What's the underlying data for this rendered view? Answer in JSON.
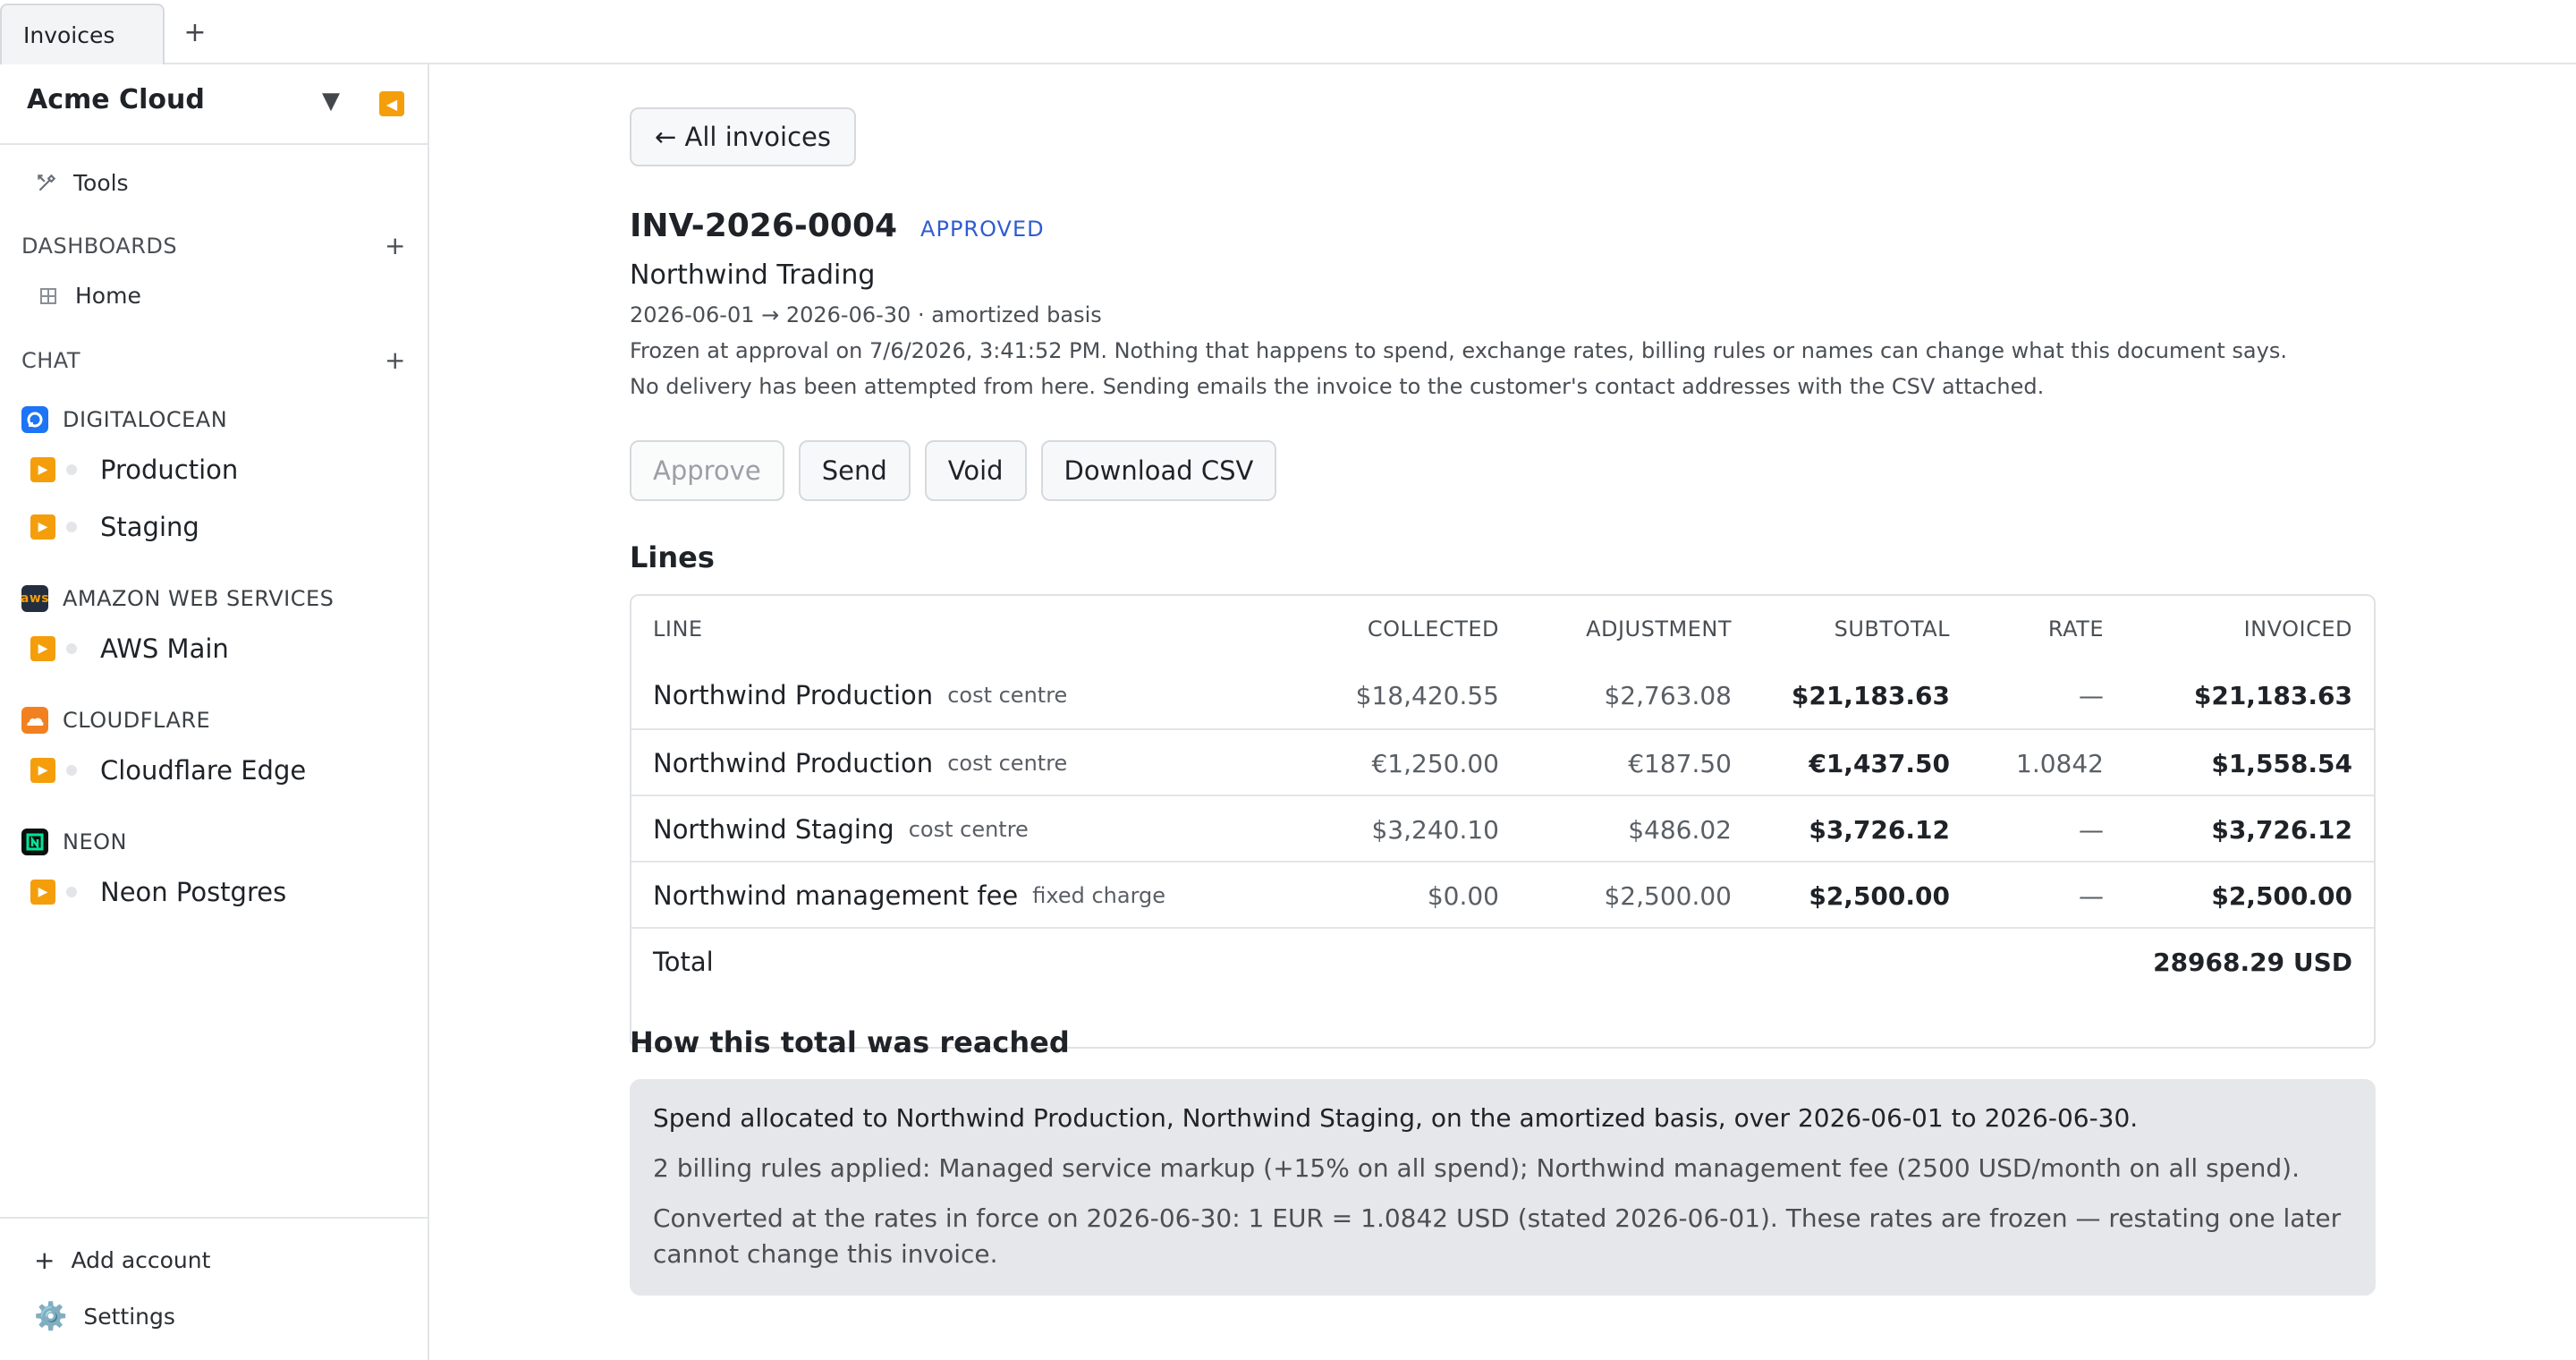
{
  "tabs": {
    "active": "Invoices",
    "add": "+"
  },
  "sidebar": {
    "org": "Acme Cloud",
    "caret": "▼",
    "collapse": "◀",
    "tools": "Tools",
    "dashboards": {
      "label": "DASHBOARDS",
      "plus": "+",
      "items": [
        {
          "label": "Home"
        }
      ]
    },
    "chat": {
      "label": "CHAT",
      "plus": "+"
    },
    "providers": [
      {
        "name": "DIGITALOCEAN",
        "color": "#1d74f5",
        "accounts": [
          "Production",
          "Staging"
        ]
      },
      {
        "name": "AMAZON WEB SERVICES",
        "color": "#232f3e",
        "accounts": [
          "AWS Main"
        ]
      },
      {
        "name": "CLOUDFLARE",
        "color": "#f38020",
        "accounts": [
          "Cloudflare Edge"
        ]
      },
      {
        "name": "NEON",
        "color": "#0b0f0e",
        "accounts": [
          "Neon Postgres"
        ]
      }
    ],
    "footer": {
      "add_account": "Add account",
      "add_icon": "+",
      "settings": "Settings",
      "settings_icon": "⚙️"
    }
  },
  "invoice": {
    "back": "← All invoices",
    "number": "INV-2026-0004",
    "status": "APPROVED",
    "customer": "Northwind Trading",
    "period": "2026-06-01 → 2026-06-30 · amortized basis",
    "frozen_note": "Frozen at approval on 7/6/2026, 3:41:52 PM. Nothing that happens to spend, exchange rates, billing rules or names can change what this document says.",
    "delivery_note": "No delivery has been attempted from here. Sending emails the invoice to the customer's contact addresses with the CSV attached.",
    "actions": {
      "approve": "Approve",
      "send": "Send",
      "void": "Void",
      "download": "Download CSV"
    }
  },
  "lines": {
    "heading": "Lines",
    "columns": {
      "line": "LINE",
      "collected": "COLLECTED",
      "adjustment": "ADJUSTMENT",
      "subtotal": "SUBTOTAL",
      "rate": "RATE",
      "invoiced": "INVOICED"
    },
    "rows": [
      {
        "name": "Northwind Production",
        "type": "cost centre",
        "collected": "$18,420.55",
        "adjustment": "$2,763.08",
        "subtotal": "$21,183.63",
        "rate": "—",
        "invoiced": "$21,183.63"
      },
      {
        "name": "Northwind Production",
        "type": "cost centre",
        "collected": "€1,250.00",
        "adjustment": "€187.50",
        "subtotal": "€1,437.50",
        "rate": "1.0842",
        "invoiced": "$1,558.54"
      },
      {
        "name": "Northwind Staging",
        "type": "cost centre",
        "collected": "$3,240.10",
        "adjustment": "$486.02",
        "subtotal": "$3,726.12",
        "rate": "—",
        "invoiced": "$3,726.12"
      },
      {
        "name": "Northwind management fee",
        "type": "fixed charge",
        "collected": "$0.00",
        "adjustment": "$2,500.00",
        "subtotal": "$2,500.00",
        "rate": "—",
        "invoiced": "$2,500.00"
      }
    ],
    "total_label": "Total",
    "total_value": "28968.29 USD"
  },
  "explanation": {
    "heading": "How this total was reached",
    "allocation": "Spend allocated to Northwind Production, Northwind Staging, on the amortized basis, over 2026-06-01 to 2026-06-30.",
    "rules": "2 billing rules applied: Managed service markup (+15% on all spend); Northwind management fee (2500 USD/month on all spend).",
    "rates": "Converted at the rates in force on 2026-06-30: 1 EUR = 1.0842 USD (stated 2026-06-01). These rates are frozen — restating one later cannot change this invoice."
  }
}
